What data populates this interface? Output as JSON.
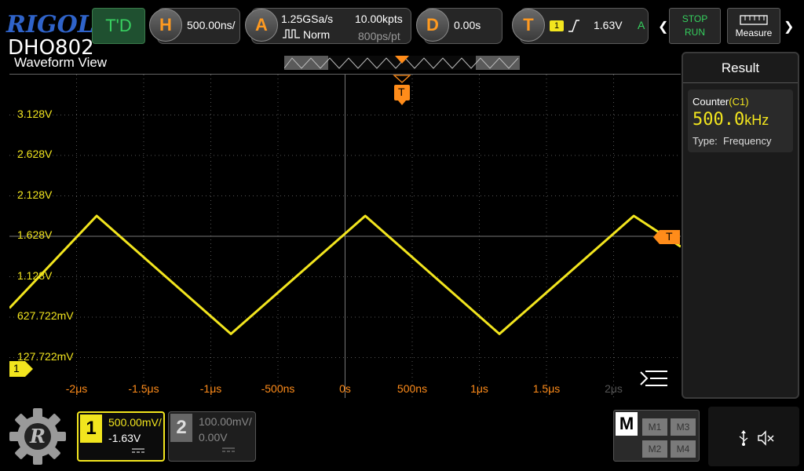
{
  "header": {
    "brand": "RIGOL",
    "model": "DHO802",
    "trig_delay_label": "T'D",
    "horizontal": {
      "key": "H",
      "timebase": "500.00ns/"
    },
    "acquire": {
      "key": "A",
      "sample_rate": "1.25GSa/s",
      "mode": "Norm",
      "memory_depth": "10.00kpts",
      "sample_interval": "800ps/pt"
    },
    "delay": {
      "key": "D",
      "value": "0.00s"
    },
    "trigger": {
      "key": "T",
      "source": "1",
      "level": "1.63V",
      "status": "A"
    },
    "stop_label": "STOP",
    "run_label": "RUN",
    "measure_label": "Measure"
  },
  "waveform_view": {
    "title": "Waveform View",
    "trigger_marker": "T",
    "trigger_level_marker": "T",
    "channel_marker": "1"
  },
  "chart_data": {
    "type": "line",
    "xlabel": "",
    "ylabel": "",
    "x_ticks": [
      "-2μs",
      "-1.5μs",
      "-1μs",
      "-500ns",
      "0s",
      "500ns",
      "1μs",
      "1.5μs",
      "2μs"
    ],
    "y_ticks": [
      "3.128V",
      "2.628V",
      "2.128V",
      "1.628V",
      "1.128V",
      "627.722mV",
      "127.722mV"
    ],
    "xlim_us": [
      -2.5,
      2.5
    ],
    "ylim_v": [
      -0.372,
      3.628
    ],
    "grid": true,
    "series": [
      {
        "color": "#f2e51e",
        "x_us": [
          -2.5,
          -1.85,
          -0.85,
          0.15,
          1.15,
          2.15,
          2.5
        ],
        "y_v": [
          0.74,
          1.88,
          0.42,
          1.88,
          0.42,
          1.88,
          1.5
        ]
      }
    ]
  },
  "result_panel": {
    "title": "Result",
    "counter_label": "Counter",
    "counter_channel": "(C1)",
    "counter_value": "500.0",
    "counter_unit": "kHz",
    "type_label": "Type:",
    "type_value": "Frequency"
  },
  "channels": [
    {
      "num": "1",
      "scale": "500.00mV/",
      "offset": "-1.63V",
      "coupling": "DC"
    },
    {
      "num": "2",
      "scale": "100.00mV/",
      "offset": "0.00V",
      "coupling": "DC"
    }
  ],
  "math": {
    "label": "M",
    "slots": [
      "M1",
      "M3",
      "M2",
      "M4"
    ]
  },
  "colors": {
    "ch1": "#f2e51e",
    "trigger": "#ff8c1a",
    "grid": "#555555"
  }
}
